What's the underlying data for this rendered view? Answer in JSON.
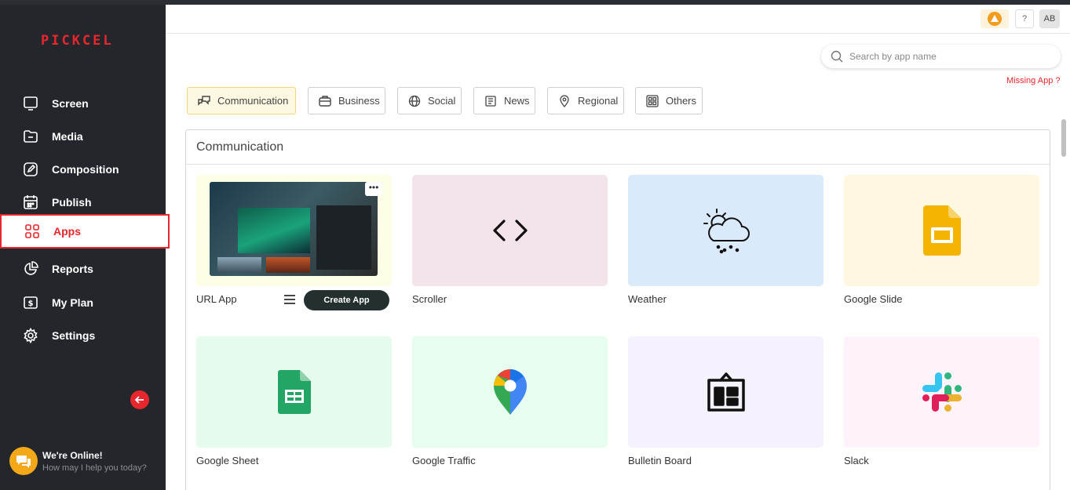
{
  "sidebar": {
    "logo": "PICKCEL",
    "items": [
      {
        "label": "Screen",
        "icon": "monitor-icon"
      },
      {
        "label": "Media",
        "icon": "folder-icon"
      },
      {
        "label": "Composition",
        "icon": "edit-icon"
      },
      {
        "label": "Publish",
        "icon": "calendar-icon"
      },
      {
        "label": "Apps",
        "icon": "grid-icon",
        "active": true
      },
      {
        "label": "Reports",
        "icon": "pie-chart-icon"
      },
      {
        "label": "My Plan",
        "icon": "wallet-icon"
      },
      {
        "label": "Settings",
        "icon": "gear-icon"
      }
    ],
    "chat": {
      "title": "We're Online!",
      "subtitle": "How may I help you today?"
    }
  },
  "header": {
    "help": "?",
    "avatar": "AB"
  },
  "search": {
    "placeholder": "Search by app name"
  },
  "missing_app": "Missing App ?",
  "tabs": [
    {
      "label": "Communication",
      "active": true
    },
    {
      "label": "Business"
    },
    {
      "label": "Social"
    },
    {
      "label": "News"
    },
    {
      "label": "Regional"
    },
    {
      "label": "Others"
    }
  ],
  "panel": {
    "title": "Communication",
    "create_app": "Create App",
    "apps": [
      {
        "label": "URL App",
        "bg": "#fefde5"
      },
      {
        "label": "Scroller",
        "bg": "#f3e4ec"
      },
      {
        "label": "Weather",
        "bg": "#dbeafb"
      },
      {
        "label": "Google Slide",
        "bg": "#fef8e1"
      },
      {
        "label": "Google Sheet",
        "bg": "#e6fbee"
      },
      {
        "label": "Google Traffic",
        "bg": "#e6fdef"
      },
      {
        "label": "Bulletin Board",
        "bg": "#f6f2fd"
      },
      {
        "label": "Slack",
        "bg": "#fef2fb"
      }
    ]
  },
  "colors": {
    "accent": "#e8262d",
    "sidebar": "#23272c"
  }
}
